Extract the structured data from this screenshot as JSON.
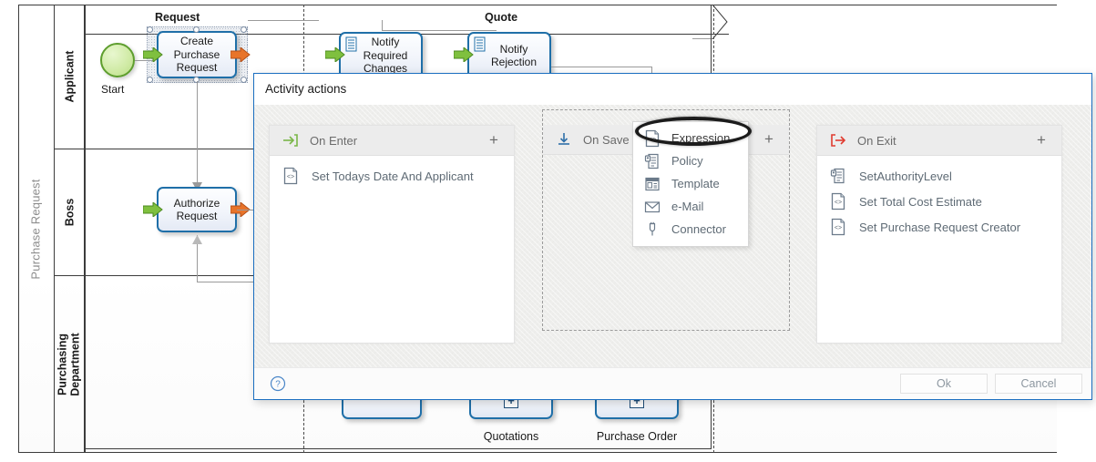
{
  "diagram": {
    "pool_label": "Purchase Request",
    "lanes": [
      {
        "label": "Applicant"
      },
      {
        "label": "Boss"
      },
      {
        "label": "Purchasing\nDepartment"
      }
    ],
    "phases": [
      {
        "label": "Request"
      },
      {
        "label": "Quote"
      }
    ],
    "start_event_label": "Start",
    "tasks": [
      {
        "label": "Create\nPurchase\nRequest",
        "selected": true
      },
      {
        "label": "Notify\nRequired\nChanges",
        "selected": false
      },
      {
        "label": "Notify\nRejection",
        "selected": false
      },
      {
        "label": "Authorize\nRequest",
        "selected": false
      }
    ],
    "data_objects": [
      {
        "label": "Quotations",
        "icon": "plus-icon"
      },
      {
        "label": "Purchase Order",
        "icon": "plus-icon"
      }
    ]
  },
  "dialog": {
    "title": "Activity actions",
    "panels": [
      {
        "key": "on_enter",
        "header_label": "On Enter",
        "header_icon": "enter-arrow-icon",
        "add_label": "+",
        "items": [
          {
            "label": "Set Todays Date And Applicant",
            "icon": "expression-icon"
          }
        ]
      },
      {
        "key": "on_save",
        "header_label": "On Save",
        "header_icon": "save-download-icon",
        "add_label": "+",
        "items": []
      },
      {
        "key": "on_exit",
        "header_label": "On Exit",
        "header_icon": "exit-arrow-icon",
        "add_label": "+",
        "items": [
          {
            "label": "SetAuthorityLevel",
            "icon": "policy-icon"
          },
          {
            "label": "Set Total Cost Estimate",
            "icon": "expression-icon"
          },
          {
            "label": "Set Purchase Request Creator",
            "icon": "expression-icon"
          }
        ]
      }
    ],
    "dropdown": {
      "items": [
        {
          "label": "Expression",
          "icon": "expression-icon",
          "highlighted": true
        },
        {
          "label": "Policy",
          "icon": "policy-icon",
          "highlighted": false
        },
        {
          "label": "Template",
          "icon": "template-icon",
          "highlighted": false
        },
        {
          "label": "e-Mail",
          "icon": "mail-icon",
          "highlighted": false
        },
        {
          "label": "Connector",
          "icon": "connector-icon",
          "highlighted": false
        }
      ]
    },
    "footer": {
      "help_icon": "help-circle-icon",
      "ok_label": "Ok",
      "cancel_label": "Cancel"
    }
  },
  "colors": {
    "dialog_border": "#1a6ec0",
    "task_border": "#1f6fa8",
    "start_border": "#5e9e2e",
    "enter_icon": "#7ab648",
    "exit_icon": "#e03b2f",
    "save_icon": "#2f6fa8",
    "panel_header_bg": "#ececec",
    "body_bg": "#eeeeec"
  }
}
